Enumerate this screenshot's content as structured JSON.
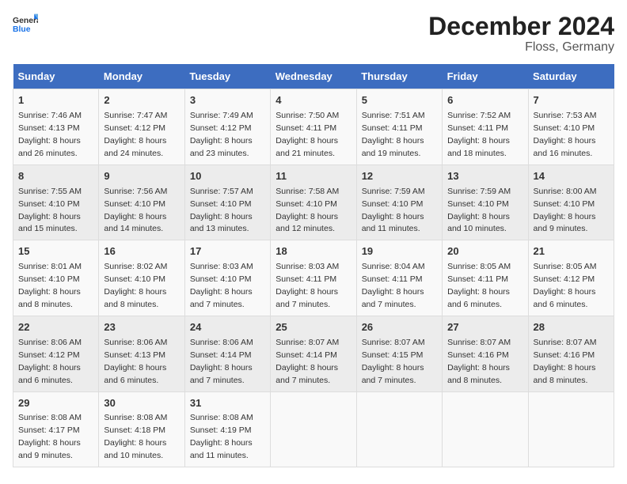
{
  "header": {
    "logo_general": "General",
    "logo_blue": "Blue",
    "main_title": "December 2024",
    "subtitle": "Floss, Germany"
  },
  "columns": [
    "Sunday",
    "Monday",
    "Tuesday",
    "Wednesday",
    "Thursday",
    "Friday",
    "Saturday"
  ],
  "weeks": [
    [
      {
        "day": "1",
        "info": "Sunrise: 7:46 AM\nSunset: 4:13 PM\nDaylight: 8 hours\nand 26 minutes."
      },
      {
        "day": "2",
        "info": "Sunrise: 7:47 AM\nSunset: 4:12 PM\nDaylight: 8 hours\nand 24 minutes."
      },
      {
        "day": "3",
        "info": "Sunrise: 7:49 AM\nSunset: 4:12 PM\nDaylight: 8 hours\nand 23 minutes."
      },
      {
        "day": "4",
        "info": "Sunrise: 7:50 AM\nSunset: 4:11 PM\nDaylight: 8 hours\nand 21 minutes."
      },
      {
        "day": "5",
        "info": "Sunrise: 7:51 AM\nSunset: 4:11 PM\nDaylight: 8 hours\nand 19 minutes."
      },
      {
        "day": "6",
        "info": "Sunrise: 7:52 AM\nSunset: 4:11 PM\nDaylight: 8 hours\nand 18 minutes."
      },
      {
        "day": "7",
        "info": "Sunrise: 7:53 AM\nSunset: 4:10 PM\nDaylight: 8 hours\nand 16 minutes."
      }
    ],
    [
      {
        "day": "8",
        "info": "Sunrise: 7:55 AM\nSunset: 4:10 PM\nDaylight: 8 hours\nand 15 minutes."
      },
      {
        "day": "9",
        "info": "Sunrise: 7:56 AM\nSunset: 4:10 PM\nDaylight: 8 hours\nand 14 minutes."
      },
      {
        "day": "10",
        "info": "Sunrise: 7:57 AM\nSunset: 4:10 PM\nDaylight: 8 hours\nand 13 minutes."
      },
      {
        "day": "11",
        "info": "Sunrise: 7:58 AM\nSunset: 4:10 PM\nDaylight: 8 hours\nand 12 minutes."
      },
      {
        "day": "12",
        "info": "Sunrise: 7:59 AM\nSunset: 4:10 PM\nDaylight: 8 hours\nand 11 minutes."
      },
      {
        "day": "13",
        "info": "Sunrise: 7:59 AM\nSunset: 4:10 PM\nDaylight: 8 hours\nand 10 minutes."
      },
      {
        "day": "14",
        "info": "Sunrise: 8:00 AM\nSunset: 4:10 PM\nDaylight: 8 hours\nand 9 minutes."
      }
    ],
    [
      {
        "day": "15",
        "info": "Sunrise: 8:01 AM\nSunset: 4:10 PM\nDaylight: 8 hours\nand 8 minutes."
      },
      {
        "day": "16",
        "info": "Sunrise: 8:02 AM\nSunset: 4:10 PM\nDaylight: 8 hours\nand 8 minutes."
      },
      {
        "day": "17",
        "info": "Sunrise: 8:03 AM\nSunset: 4:10 PM\nDaylight: 8 hours\nand 7 minutes."
      },
      {
        "day": "18",
        "info": "Sunrise: 8:03 AM\nSunset: 4:11 PM\nDaylight: 8 hours\nand 7 minutes."
      },
      {
        "day": "19",
        "info": "Sunrise: 8:04 AM\nSunset: 4:11 PM\nDaylight: 8 hours\nand 7 minutes."
      },
      {
        "day": "20",
        "info": "Sunrise: 8:05 AM\nSunset: 4:11 PM\nDaylight: 8 hours\nand 6 minutes."
      },
      {
        "day": "21",
        "info": "Sunrise: 8:05 AM\nSunset: 4:12 PM\nDaylight: 8 hours\nand 6 minutes."
      }
    ],
    [
      {
        "day": "22",
        "info": "Sunrise: 8:06 AM\nSunset: 4:12 PM\nDaylight: 8 hours\nand 6 minutes."
      },
      {
        "day": "23",
        "info": "Sunrise: 8:06 AM\nSunset: 4:13 PM\nDaylight: 8 hours\nand 6 minutes."
      },
      {
        "day": "24",
        "info": "Sunrise: 8:06 AM\nSunset: 4:14 PM\nDaylight: 8 hours\nand 7 minutes."
      },
      {
        "day": "25",
        "info": "Sunrise: 8:07 AM\nSunset: 4:14 PM\nDaylight: 8 hours\nand 7 minutes."
      },
      {
        "day": "26",
        "info": "Sunrise: 8:07 AM\nSunset: 4:15 PM\nDaylight: 8 hours\nand 7 minutes."
      },
      {
        "day": "27",
        "info": "Sunrise: 8:07 AM\nSunset: 4:16 PM\nDaylight: 8 hours\nand 8 minutes."
      },
      {
        "day": "28",
        "info": "Sunrise: 8:07 AM\nSunset: 4:16 PM\nDaylight: 8 hours\nand 8 minutes."
      }
    ],
    [
      {
        "day": "29",
        "info": "Sunrise: 8:08 AM\nSunset: 4:17 PM\nDaylight: 8 hours\nand 9 minutes."
      },
      {
        "day": "30",
        "info": "Sunrise: 8:08 AM\nSunset: 4:18 PM\nDaylight: 8 hours\nand 10 minutes."
      },
      {
        "day": "31",
        "info": "Sunrise: 8:08 AM\nSunset: 4:19 PM\nDaylight: 8 hours\nand 11 minutes."
      },
      null,
      null,
      null,
      null
    ]
  ]
}
